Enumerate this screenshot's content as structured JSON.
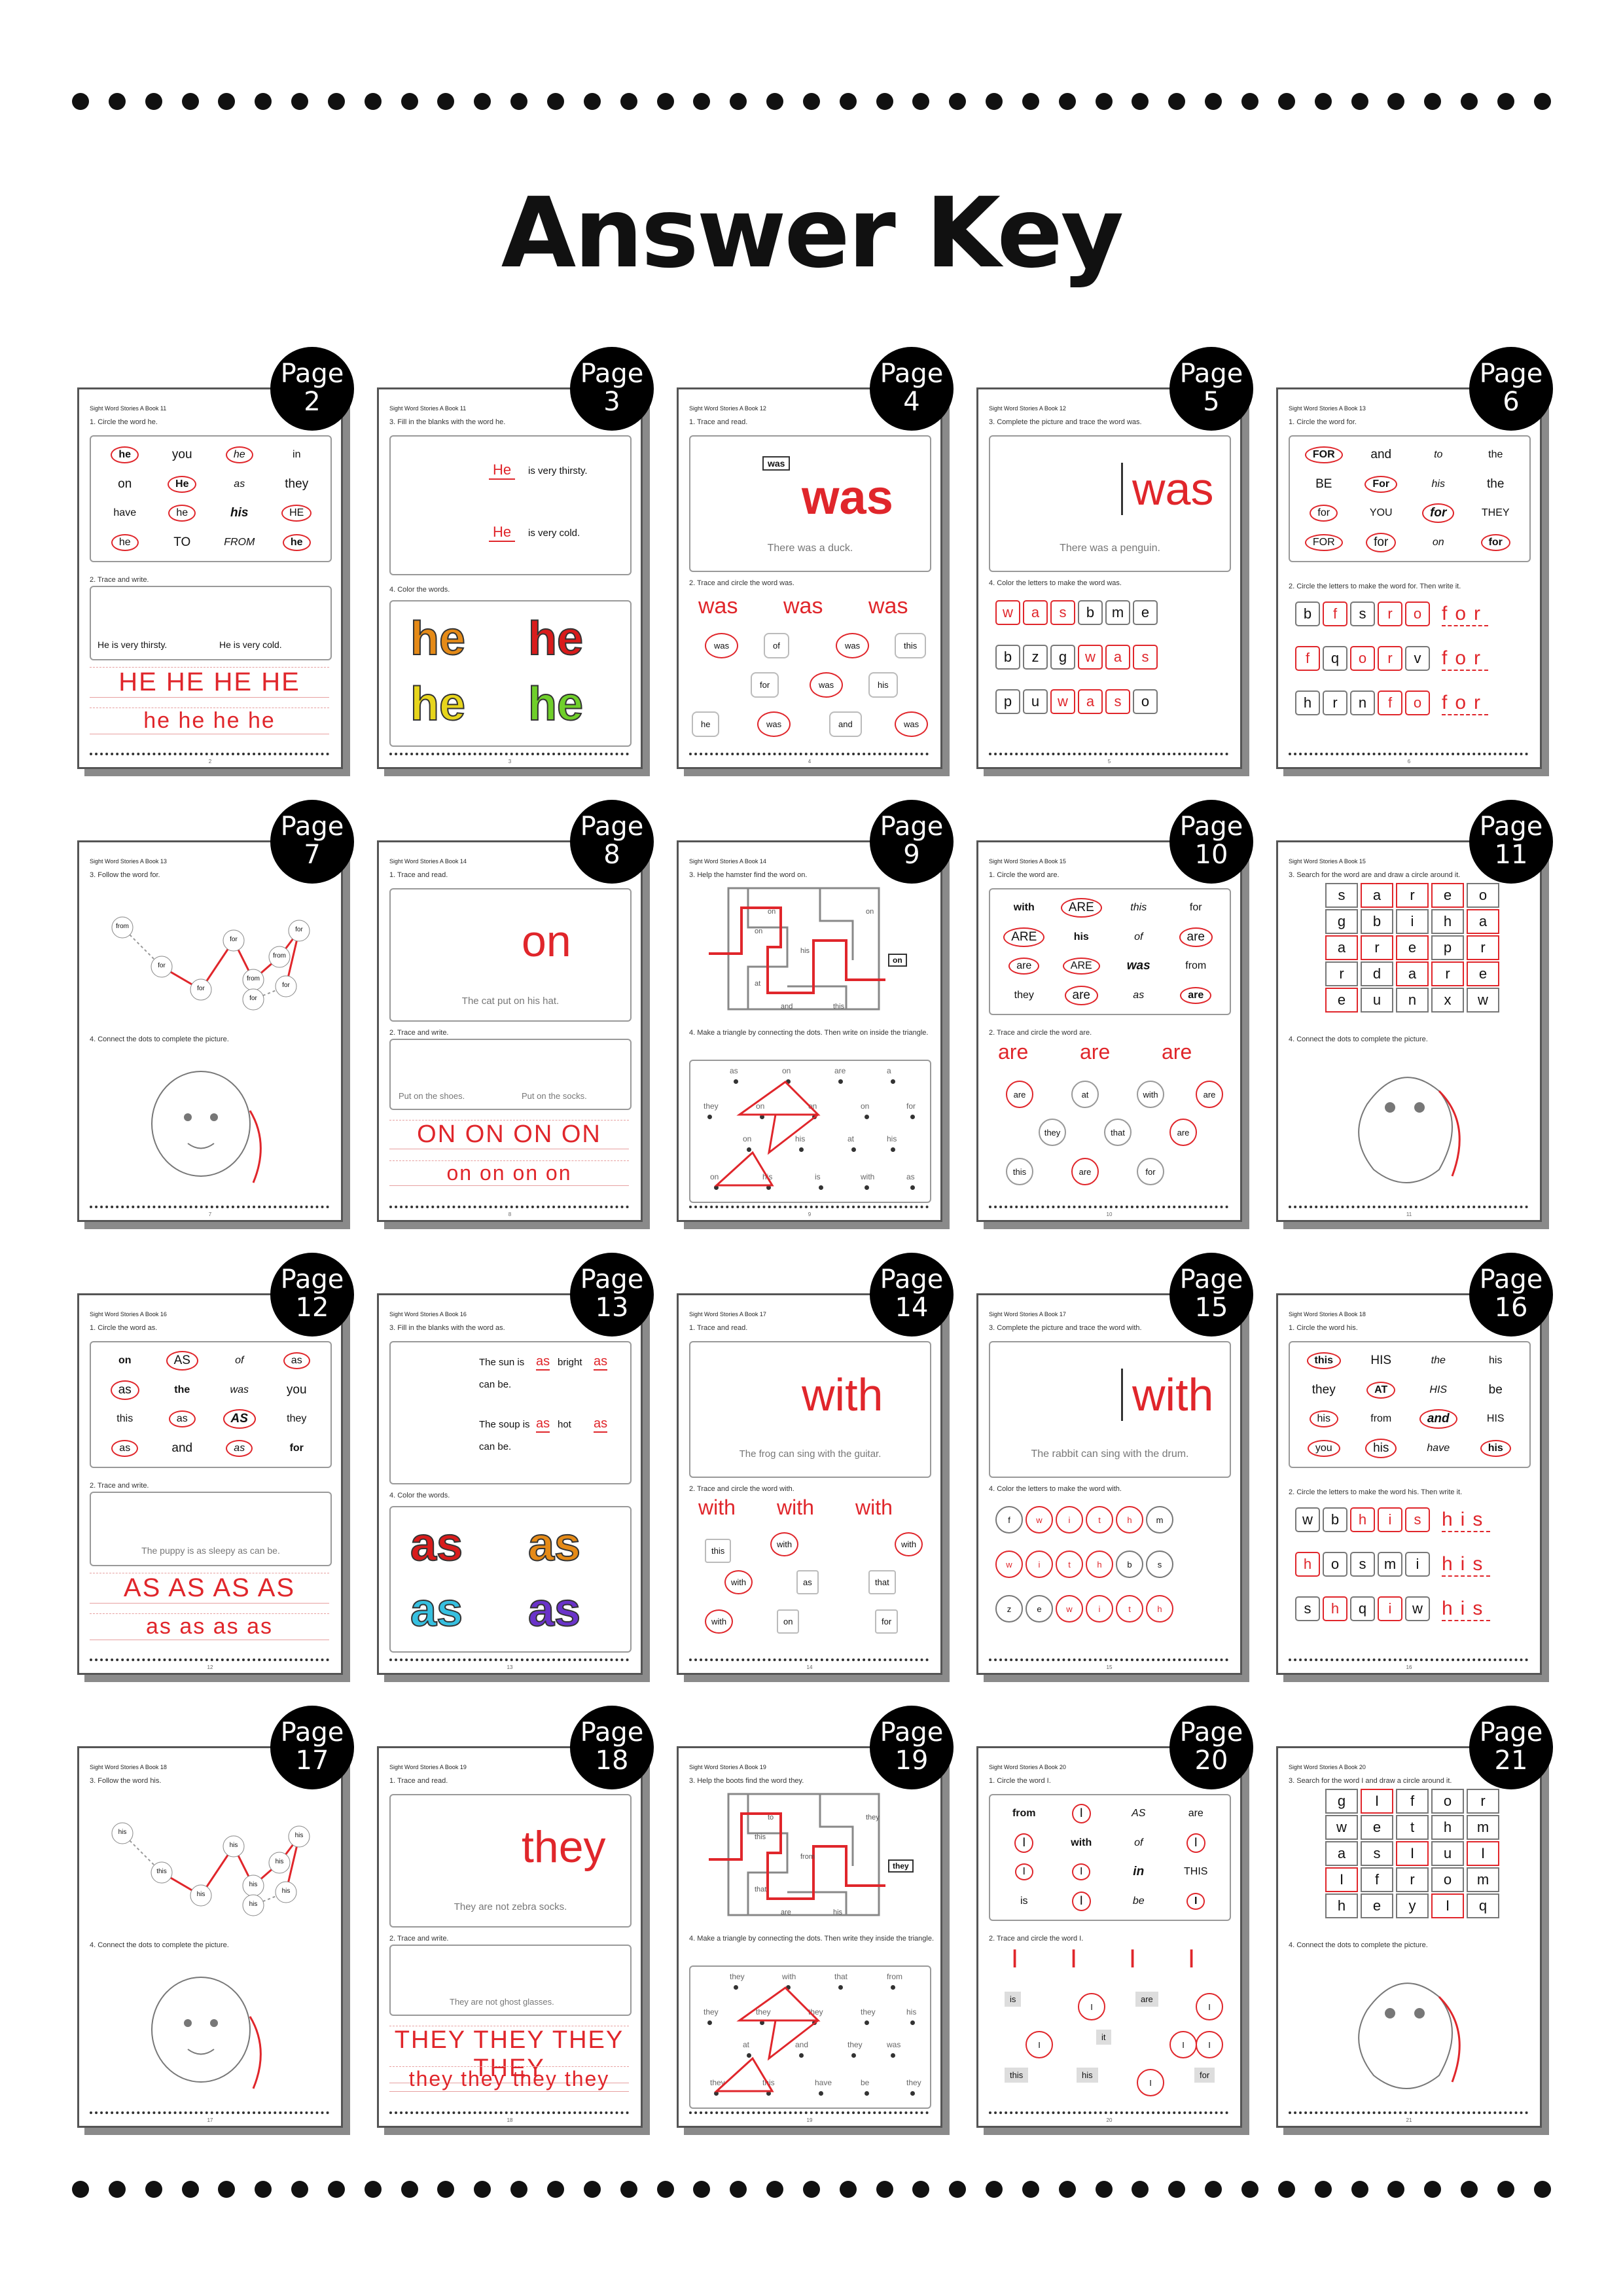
{
  "title": "Answer Key",
  "badge_word": "Page",
  "pages": [
    {
      "num": "2",
      "header": "Sight Word Stories A Book 11",
      "ins1": "1. Circle the word he.",
      "ins2": "2. Trace and write.",
      "grid": [
        "he",
        "you",
        "he",
        "in",
        "on",
        "He",
        "as",
        "they",
        "have",
        "he",
        "his",
        "HE",
        "he",
        "TO",
        "FROM",
        "he"
      ],
      "caption1": "He is very thirsty.",
      "caption2": "He is very cold.",
      "upper": "HE",
      "lower": "he"
    },
    {
      "num": "3",
      "header": "Sight Word Stories A Book 11",
      "ins1": "3. Fill in the blanks with the word he.",
      "ins2": "4. Color the words.",
      "sent1": "is very thirsty.",
      "sent2": "is very cold.",
      "word": "he",
      "blank": "He"
    },
    {
      "num": "4",
      "header": "Sight Word Stories A Book 12",
      "ins1": "1. Trace and read.",
      "ins2": "2. Trace and circle the word was.",
      "sign": "was",
      "word": "was",
      "caption": "There was a duck.",
      "logs": [
        "was",
        "of",
        "was",
        "this",
        "for",
        "was",
        "his",
        "he",
        "was",
        "and",
        "was"
      ]
    },
    {
      "num": "5",
      "header": "Sight Word Stories A Book 12",
      "ins1": "3. Complete the picture and trace the word was.",
      "ins2": "4. Color the letters to make the word was.",
      "word": "was",
      "caption": "There was a penguin.",
      "rows": [
        [
          "w",
          "a",
          "s",
          "b",
          "m",
          "e"
        ],
        [
          "b",
          "z",
          "g",
          "w",
          "a",
          "s"
        ],
        [
          "p",
          "u",
          "w",
          "a",
          "s",
          "o"
        ]
      ]
    },
    {
      "num": "6",
      "header": "Sight Word Stories A Book 13",
      "ins1": "1. Circle the word for.",
      "ins2": "2. Circle the letters to make the word for. Then write it.",
      "grid": [
        "FOR",
        "and",
        "to",
        "the",
        "BE",
        "For",
        "his",
        "the",
        "for",
        "YOU",
        "for",
        "THEY",
        "FOR",
        "for",
        "on",
        "for"
      ],
      "rows": [
        [
          "b",
          "f",
          "s",
          "r",
          "o"
        ],
        [
          "f",
          "q",
          "o",
          "r",
          "v"
        ],
        [
          "h",
          "r",
          "n",
          "f",
          "o"
        ]
      ],
      "write": "for"
    },
    {
      "num": "7",
      "header": "Sight Word Stories A Book 13",
      "ins1": "3. Follow the word for.",
      "ins2": "4. Connect the dots to complete the picture.",
      "path": [
        "from",
        "for",
        "for",
        "for",
        "from",
        "from",
        "for",
        "for",
        "for"
      ]
    },
    {
      "num": "8",
      "header": "Sight Word Stories A Book 14",
      "ins1": "1. Trace and read.",
      "ins2": "2. Trace and write.",
      "word": "on",
      "caption": "The cat put on his hat.",
      "caption1": "Put on the shoes.",
      "caption2": "Put on the socks.",
      "upper": "ON",
      "lower": "on"
    },
    {
      "num": "9",
      "header": "Sight Word Stories A Book 14",
      "ins1": "3. Help the hamster find the word on.",
      "ins2": "4. Make a triangle by connecting the dots. Then write on inside the triangle.",
      "maze": [
        "on",
        "his",
        "at",
        "on",
        "on",
        "and",
        "this"
      ],
      "sign": "on",
      "dots": [
        "as",
        "on",
        "are",
        "a",
        "they",
        "on",
        "on",
        "on",
        "for",
        "on",
        "his",
        "at",
        "his",
        "on",
        "his",
        "is",
        "with",
        "as"
      ]
    },
    {
      "num": "10",
      "header": "Sight Word Stories A Book 15",
      "ins1": "1. Circle the word are.",
      "ins2": "2. Trace and circle the word are.",
      "grid": [
        "with",
        "ARE",
        "this",
        "for",
        "ARE",
        "his",
        "of",
        "are",
        "are",
        "ARE",
        "was",
        "from",
        "they",
        "are",
        "as",
        "are"
      ],
      "word": "are",
      "apples": [
        "are",
        "at",
        "with",
        "are",
        "they",
        "that",
        "are",
        "this",
        "are",
        "for"
      ]
    },
    {
      "num": "11",
      "header": "Sight Word Stories A Book 15",
      "ins1": "3. Search for the word are and draw a circle around it.",
      "ins2": "4. Connect the dots to complete the picture.",
      "rows": [
        [
          "s",
          "a",
          "r",
          "e",
          "o"
        ],
        [
          "g",
          "b",
          "i",
          "h",
          "a"
        ],
        [
          "a",
          "r",
          "e",
          "p",
          "r"
        ],
        [
          "r",
          "d",
          "a",
          "r",
          "e"
        ],
        [
          "e",
          "u",
          "n",
          "x",
          "w"
        ]
      ]
    },
    {
      "num": "12",
      "header": "Sight Word Stories A Book 16",
      "ins1": "1. Circle the word as.",
      "ins2": "2. Trace and write.",
      "grid": [
        "on",
        "AS",
        "of",
        "as",
        "as",
        "the",
        "was",
        "you",
        "this",
        "as",
        "AS",
        "they",
        "as",
        "and",
        "as",
        "for"
      ],
      "caption": "The puppy is as sleepy as can be.",
      "upper": "AS",
      "lower": "as"
    },
    {
      "num": "13",
      "header": "Sight Word Stories A Book 16",
      "ins1": "3. Fill in the blanks with the word as.",
      "ins2": "4. Color the words.",
      "sent1a": "The sun is",
      "sent1b": "bright",
      "sent1c": "can be.",
      "sent2a": "The soup is",
      "sent2b": "hot",
      "sent2c": "can be.",
      "blank": "as",
      "word": "as"
    },
    {
      "num": "14",
      "header": "Sight Word Stories A Book 17",
      "ins1": "1. Trace and read.",
      "ins2": "2. Trace and circle the word with.",
      "word": "with",
      "caption": "The frog can sing with the guitar.",
      "houses": [
        "this",
        "with",
        "with",
        "with",
        "as",
        "that",
        "with",
        "on",
        "for"
      ]
    },
    {
      "num": "15",
      "header": "Sight Word Stories A Book 17",
      "ins1": "3. Complete the picture and trace the word with.",
      "ins2": "4. Color the letters to make the word with.",
      "word": "with",
      "caption": "The rabbit can sing with the drum.",
      "rows": [
        [
          "f",
          "w",
          "i",
          "t",
          "h",
          "m"
        ],
        [
          "w",
          "i",
          "t",
          "h",
          "b",
          "s"
        ],
        [
          "z",
          "e",
          "w",
          "i",
          "t",
          "h"
        ]
      ]
    },
    {
      "num": "16",
      "header": "Sight Word Stories A Book 18",
      "ins1": "1. Circle the word his.",
      "ins2": "2. Circle the letters to make the word his. Then write it.",
      "grid": [
        "this",
        "HIS",
        "the",
        "his",
        "they",
        "AT",
        "HIS",
        "be",
        "his",
        "from",
        "and",
        "HIS",
        "you",
        "his",
        "have",
        "his"
      ],
      "rows": [
        [
          "w",
          "b",
          "h",
          "i",
          "s"
        ],
        [
          "h",
          "o",
          "s",
          "m",
          "i"
        ],
        [
          "s",
          "h",
          "q",
          "i",
          "w"
        ]
      ],
      "write": "his"
    },
    {
      "num": "17",
      "header": "Sight Word Stories A Book 18",
      "ins1": "3. Follow the word his.",
      "ins2": "4. Connect the dots to complete the picture.",
      "path": [
        "his",
        "this",
        "his",
        "his",
        "his",
        "his",
        "his",
        "his",
        "his"
      ]
    },
    {
      "num": "18",
      "header": "Sight Word Stories A Book 19",
      "ins1": "1. Trace and read.",
      "ins2": "2. Trace and write.",
      "word": "they",
      "caption": "They are not zebra socks.",
      "caption2": "They are not ghost glasses.",
      "upper": "THEY",
      "lower": "they"
    },
    {
      "num": "19",
      "header": "Sight Word Stories A Book 19",
      "ins1": "3. Help the boots find the word they.",
      "ins2": "4. Make a triangle by connecting the dots. Then write they inside the triangle.",
      "maze": [
        "this",
        "from",
        "that",
        "to",
        "they",
        "are",
        "his"
      ],
      "sign": "they",
      "dots": [
        "they",
        "with",
        "that",
        "from",
        "they",
        "they",
        "they",
        "they",
        "his",
        "at",
        "and",
        "they",
        "was",
        "they",
        "this",
        "have",
        "be",
        "they"
      ]
    },
    {
      "num": "20",
      "header": "Sight Word Stories A Book 20",
      "ins1": "1. Circle the word I.",
      "ins2": "2. Trace and circle the word I.",
      "grid": [
        "from",
        "I",
        "AS",
        "are",
        "I",
        "with",
        "of",
        "I",
        "I",
        "I",
        "in",
        "THIS",
        "is",
        "I",
        "be",
        "I"
      ],
      "word": "I",
      "signs": [
        "is",
        "I",
        "are",
        "I",
        "I",
        "it",
        "I",
        "I",
        "this",
        "his",
        "I",
        "for"
      ]
    },
    {
      "num": "21",
      "header": "Sight Word Stories A Book 20",
      "ins1": "3. Search for the word I and draw a circle around it.",
      "ins2": "4. Connect the dots to complete the picture.",
      "rows": [
        [
          "g",
          "I",
          "f",
          "o",
          "r"
        ],
        [
          "w",
          "e",
          "t",
          "h",
          "m"
        ],
        [
          "a",
          "s",
          "I",
          "u",
          "I"
        ],
        [
          "I",
          "f",
          "r",
          "o",
          "m"
        ],
        [
          "h",
          "e",
          "y",
          "I",
          "q"
        ]
      ]
    }
  ]
}
